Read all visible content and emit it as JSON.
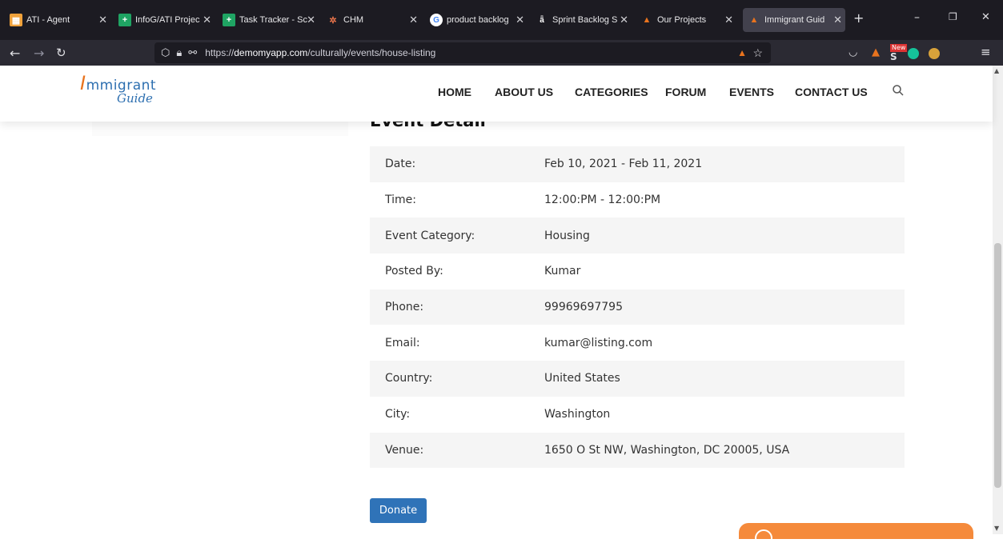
{
  "browser": {
    "tabs": [
      {
        "label": "ATI - Agent",
        "icon": "grid-icon",
        "color": "#f0a23b"
      },
      {
        "label": "InfoG/ATI Projec",
        "icon": "sheets-icon",
        "color": "#1fa463"
      },
      {
        "label": "Task Tracker - Sc",
        "icon": "sheets-icon",
        "color": "#1fa463"
      },
      {
        "label": "CHM",
        "icon": "chm-icon",
        "color": "#e8734a"
      },
      {
        "label": "product backlog",
        "icon": "google-icon",
        "color": "#ffffff"
      },
      {
        "label": "Sprint Backlog S",
        "icon": "sprint-icon",
        "color": "#ffffff"
      },
      {
        "label": "Our Projects",
        "icon": "site-icon",
        "color": "#e8731e"
      },
      {
        "label": "Immigrant Guid",
        "icon": "site-icon",
        "color": "#e8731e"
      }
    ],
    "url_prefix": "https://",
    "url_domain": "demomyapp.com",
    "url_path": "/culturally/events/house-listing",
    "new_badge": "New"
  },
  "site": {
    "logo_line1_initial": "I",
    "logo_line1_rest": "mmigrant",
    "logo_line2": "Guide",
    "nav": [
      "HOME",
      "ABOUT US",
      "CATEGORIES",
      "FORUM",
      "EVENTS",
      "CONTACT US"
    ]
  },
  "event": {
    "heading": "Event Detail",
    "rows": [
      {
        "key": "Date:",
        "value": "Feb 10, 2021 - Feb 11, 2021"
      },
      {
        "key": "Time:",
        "value": "12:00:PM - 12:00:PM"
      },
      {
        "key": "Event Category:",
        "value": "Housing"
      },
      {
        "key": "Posted By:",
        "value": "Kumar"
      },
      {
        "key": "Phone:",
        "value": "99969697795"
      },
      {
        "key": "Email:",
        "value": "kumar@listing.com"
      },
      {
        "key": "Country:",
        "value": "United States"
      },
      {
        "key": "City:",
        "value": "Washington"
      },
      {
        "key": "Venue:",
        "value": "1650 O St NW, Washington, DC 20005, USA"
      }
    ],
    "donate_label": "Donate"
  }
}
